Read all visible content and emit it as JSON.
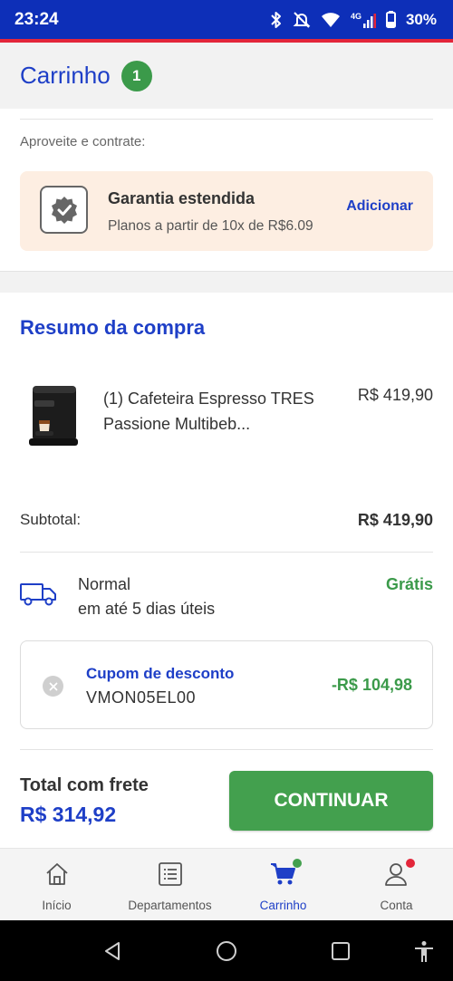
{
  "status_bar": {
    "time": "23:24",
    "network": "4G",
    "battery": "30%"
  },
  "header": {
    "title": "Carrinho",
    "count": "1"
  },
  "warranty": {
    "hint": "Aproveite e contrate:",
    "title": "Garantia estendida",
    "subtitle": "Planos a partir de 10x de R$6.09",
    "action": "Adicionar"
  },
  "summary": {
    "title": "Resumo da compra",
    "item": {
      "name": "(1) Cafeteira Espresso TRES Passione Multibeb...",
      "price": "R$ 419,90"
    },
    "subtotal_label": "Subtotal:",
    "subtotal_value": "R$ 419,90"
  },
  "shipping": {
    "name": "Normal",
    "time": "em até 5 dias úteis",
    "price": "Grátis"
  },
  "coupon": {
    "title": "Cupom de desconto",
    "code": "VMON05EL00",
    "value": "-R$ 104,98"
  },
  "total": {
    "label": "Total com frete",
    "value": "R$ 314,92",
    "button": "CONTINUAR"
  },
  "bottom_nav": {
    "items": [
      {
        "label": "Início",
        "icon": "home-icon"
      },
      {
        "label": "Departamentos",
        "icon": "list-icon"
      },
      {
        "label": "Carrinho",
        "icon": "cart-icon",
        "active": true
      },
      {
        "label": "Conta",
        "icon": "user-icon"
      }
    ]
  },
  "colors": {
    "brand_blue": "#1e3fc7",
    "status_blue": "#0d2fb8",
    "green": "#43a04e",
    "accent_red": "#e3263a",
    "warranty_bg": "#fdeee2"
  }
}
